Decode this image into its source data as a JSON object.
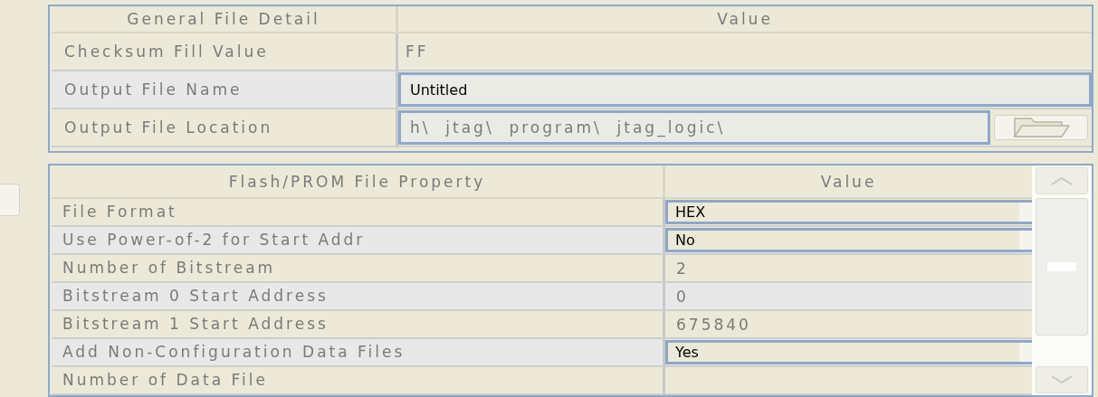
{
  "general": {
    "columns": [
      "General File Detail",
      "Value"
    ],
    "rows": [
      {
        "label": "Checksum Fill Value",
        "value": "FF",
        "kind": "static"
      },
      {
        "label": "Output File Name",
        "value": "Untitled",
        "kind": "text"
      },
      {
        "label": "Output File Location",
        "value": "h\\  jtag\\  program\\  jtag_logic\\",
        "kind": "path"
      }
    ]
  },
  "flash": {
    "columns": [
      "Flash/PROM File Property",
      "Value"
    ],
    "rows": [
      {
        "label": "File Format",
        "value": "HEX",
        "kind": "dropdown"
      },
      {
        "label": "Use Power-of-2 for Start Addr",
        "value": "No",
        "kind": "dropdown"
      },
      {
        "label": "Number of Bitstream",
        "value": "2",
        "kind": "static"
      },
      {
        "label": "Bitstream 0 Start Address",
        "value": "0",
        "kind": "static"
      },
      {
        "label": "Bitstream 1 Start Address",
        "value": "675840",
        "kind": "static"
      },
      {
        "label": "Add Non-Configuration Data Files",
        "value": "Yes",
        "kind": "dropdown"
      },
      {
        "label": "Number of Data File",
        "kind": "static"
      }
    ]
  }
}
